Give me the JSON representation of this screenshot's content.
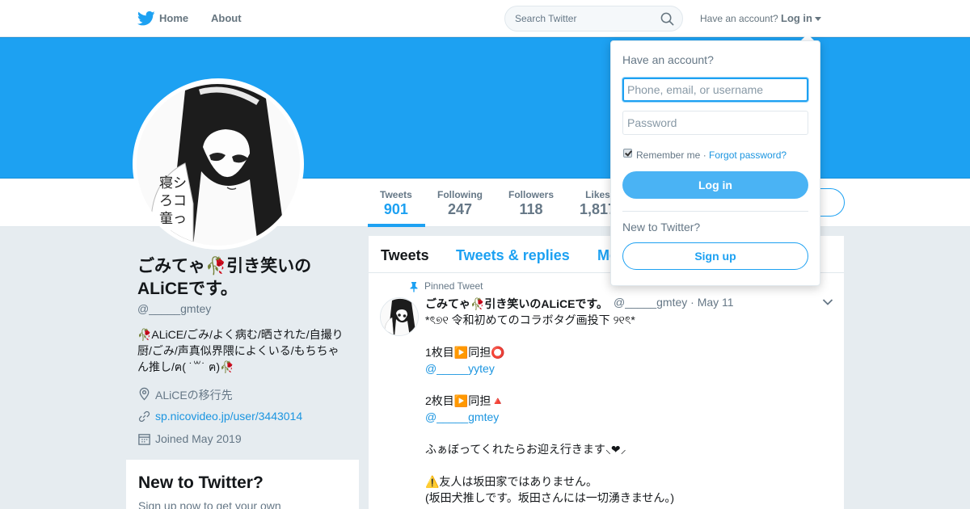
{
  "nav": {
    "home_label": "Home",
    "about_label": "About",
    "search_placeholder": "Search Twitter",
    "have_account": "Have an account?",
    "login_label": "Log in",
    "brand_color": "#1da1f2"
  },
  "profile": {
    "name_line1": "ごみてゃ🥀引き笑いの",
    "name_line2": "ALiCEです。",
    "handle": "@_____gmtey",
    "bio": "🥀ALiCE/ごみ/よく病む/晒された/自撮り厨/ごみ/声真似界隈によくいる/もちちゃん推し/ฅ( ˙꒳˙ ฅ)🥀",
    "location": "ALiCEの移行先",
    "website": "sp.nicovideo.jp/user/3443014",
    "joined": "Joined May 2019",
    "icons": {
      "location": "location-pin-icon",
      "website": "link-icon",
      "joined": "calendar-icon"
    }
  },
  "stats": [
    {
      "label": "Tweets",
      "value": "901"
    },
    {
      "label": "Following",
      "value": "247"
    },
    {
      "label": "Followers",
      "value": "118"
    },
    {
      "label": "Likes",
      "value": "1,817"
    }
  ],
  "signup_card": {
    "title": "New to Twitter?",
    "subtitle": "Sign up now to get your own"
  },
  "timeline": {
    "tabs": [
      "Tweets",
      "Tweets & replies",
      "Media"
    ],
    "pinned_label": "Pinned Tweet",
    "tweet": {
      "author": "ごみてゃ🥀引き笑いのALiCEです。",
      "handle_date": "@_____gmtey · May 11",
      "lines": [
        {
          "text": "*ৎ୭୧ 令和初めてのコラボタグ画投下 ୨୧ৎ*",
          "link": false
        },
        {
          "text": "",
          "link": false
        },
        {
          "text": "1枚目▶️同担⭕️",
          "link": false
        },
        {
          "text": "@_____yytey",
          "link": true
        },
        {
          "text": "",
          "link": false
        },
        {
          "text": "2枚目▶️同担🔺",
          "link": false
        },
        {
          "text": "@_____gmtey",
          "link": true
        },
        {
          "text": "",
          "link": false
        },
        {
          "text": "ふぁぼってくれたらお迎え行きます⸜❤︎⸝",
          "link": false
        },
        {
          "text": "",
          "link": false
        },
        {
          "text": "⚠️友人は坂田家ではありません。",
          "link": false
        },
        {
          "text": "(坂田犬推しです。坂田さんには一切湧きません。)",
          "link": false
        }
      ]
    }
  },
  "login_dropdown": {
    "title": "Have an account?",
    "username_placeholder": "Phone, email, or username",
    "password_placeholder": "Password",
    "remember_me": "Remember me",
    "separator": " · ",
    "forgot_password": "Forgot password?",
    "login_button": "Log in",
    "new_to_twitter": "New to Twitter?",
    "signup_button": "Sign up"
  }
}
